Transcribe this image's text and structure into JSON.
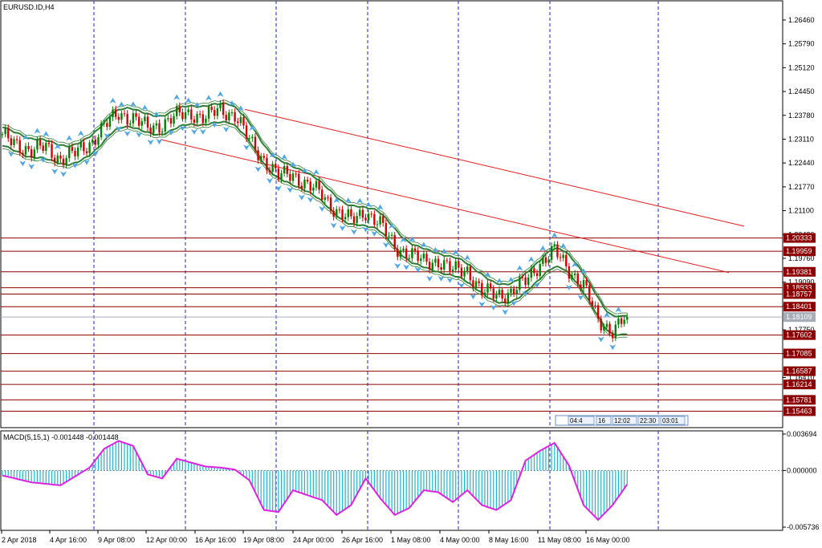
{
  "window": {
    "title": "EURUSD.ID,H4",
    "macd_label": "MACD(5,15,1) -0.001448 -0.001448"
  },
  "colors": {
    "bull_candle": "#008000",
    "bear_candle": "#d00000",
    "band": "#2e7d32",
    "channel": "#e31a1c",
    "level_line": "#8b0000",
    "macd_hist": "#1fb5c7",
    "macd_signal": "#e020e0",
    "grid": "#2020c0",
    "fractal": "#4da6e6",
    "current_price": "#a7adb7"
  },
  "price_axis": {
    "ticks": [
      "1.26460",
      "1.25790",
      "1.25120",
      "1.24450",
      "1.23780",
      "1.23110",
      "1.22440",
      "1.21770",
      "1.21100",
      "1.20430",
      "1.19760",
      "1.19090",
      "1.18420",
      "1.17750",
      "1.17080",
      "1.16410"
    ],
    "range": [
      1.15,
      1.27
    ]
  },
  "price_levels": [
    {
      "label": "1.20333",
      "price": 1.20333,
      "style": "level"
    },
    {
      "label": "1.19959",
      "price": 1.19959,
      "style": "level"
    },
    {
      "label": "1.19381",
      "price": 1.19381,
      "style": "level"
    },
    {
      "label": "1.18933",
      "price": 1.18933,
      "style": "level"
    },
    {
      "label": "1.18757",
      "price": 1.18757,
      "style": "level"
    },
    {
      "label": "1.18401",
      "price": 1.18401,
      "style": "level"
    },
    {
      "label": "1.18109",
      "price": 1.18109,
      "style": "current"
    },
    {
      "label": "1.17602",
      "price": 1.17602,
      "style": "level"
    },
    {
      "label": "1.17085",
      "price": 1.17085,
      "style": "level"
    },
    {
      "label": "1.16587",
      "price": 1.16587,
      "style": "level"
    },
    {
      "label": "1.16214",
      "price": 1.16214,
      "style": "level"
    },
    {
      "label": "1.15781",
      "price": 1.15781,
      "style": "level"
    },
    {
      "label": "1.15463",
      "price": 1.15463,
      "style": "level"
    }
  ],
  "macd_axis": {
    "ticks": [
      "0.003694",
      "0.000000",
      "-0.005736"
    ],
    "range": [
      -0.005736,
      0.003694
    ]
  },
  "time_axis": [
    "2 Apr 2018",
    "4 Apr 16:00",
    "9 Apr 08:00",
    "12 Apr 00:00",
    "16 Apr 16:00",
    "19 Apr 08:00",
    "24 Apr 00:00",
    "26 Apr 16:00",
    "1 May 08:00",
    "4 May 00:00",
    "8 May 16:00",
    "11 May 08:00",
    "16 May 00:00"
  ],
  "time_boxes": [
    "04:4",
    "16",
    "12:02",
    "22:30",
    "03:01"
  ],
  "chart_data": {
    "type": "candlestick",
    "symbol": "EURUSD.ID",
    "timeframe": "H4",
    "close_anchors": [
      [
        0,
        1.2315
      ],
      [
        5,
        1.23
      ],
      [
        10,
        1.2275
      ],
      [
        15,
        1.229
      ],
      [
        20,
        1.2255
      ],
      [
        25,
        1.227
      ],
      [
        30,
        1.23
      ],
      [
        35,
        1.2345
      ],
      [
        40,
        1.2385
      ],
      [
        45,
        1.237
      ],
      [
        50,
        1.234
      ],
      [
        55,
        1.2355
      ],
      [
        60,
        1.2375
      ],
      [
        65,
        1.2385
      ],
      [
        70,
        1.237
      ],
      [
        75,
        1.2395
      ],
      [
        80,
        1.238
      ],
      [
        85,
        1.2305
      ],
      [
        90,
        1.2255
      ],
      [
        95,
        1.2205
      ],
      [
        100,
        1.2215
      ],
      [
        105,
        1.218
      ],
      [
        110,
        1.2155
      ],
      [
        115,
        1.211
      ],
      [
        120,
        1.208
      ],
      [
        125,
        1.211
      ],
      [
        130,
        1.207
      ],
      [
        135,
        1.201
      ],
      [
        140,
        1.199
      ],
      [
        145,
        1.1965
      ],
      [
        150,
        1.197
      ],
      [
        155,
        1.194
      ],
      [
        160,
        1.1945
      ],
      [
        165,
        1.188
      ],
      [
        170,
        1.1875
      ],
      [
        175,
        1.188
      ],
      [
        180,
        1.191
      ],
      [
        185,
        1.1965
      ],
      [
        190,
        1.1995
      ],
      [
        195,
        1.1945
      ],
      [
        200,
        1.19
      ],
      [
        205,
        1.18
      ],
      [
        210,
        1.1775
      ],
      [
        215,
        1.181
      ]
    ],
    "last_close": 1.18109,
    "macd_anchors": [
      [
        0,
        -0.0005
      ],
      [
        10,
        -0.0012
      ],
      [
        20,
        -0.0015
      ],
      [
        30,
        0.0003
      ],
      [
        35,
        0.0022
      ],
      [
        40,
        0.003
      ],
      [
        45,
        0.0025
      ],
      [
        50,
        -0.0004
      ],
      [
        55,
        -0.0008
      ],
      [
        60,
        0.0012
      ],
      [
        65,
        0.0008
      ],
      [
        70,
        0.0004
      ],
      [
        75,
        0.0003
      ],
      [
        80,
        0.0001
      ],
      [
        85,
        -0.001
      ],
      [
        90,
        -0.004
      ],
      [
        95,
        -0.0042
      ],
      [
        100,
        -0.002
      ],
      [
        105,
        -0.0025
      ],
      [
        110,
        -0.003
      ],
      [
        115,
        -0.0045
      ],
      [
        120,
        -0.0035
      ],
      [
        125,
        -0.0008
      ],
      [
        130,
        -0.0028
      ],
      [
        135,
        -0.0045
      ],
      [
        140,
        -0.0038
      ],
      [
        145,
        -0.002
      ],
      [
        150,
        -0.0022
      ],
      [
        155,
        -0.0032
      ],
      [
        160,
        -0.002
      ],
      [
        165,
        -0.0035
      ],
      [
        170,
        -0.004
      ],
      [
        175,
        -0.003
      ],
      [
        180,
        0.001
      ],
      [
        185,
        0.002
      ],
      [
        190,
        0.0028
      ],
      [
        195,
        0.0005
      ],
      [
        200,
        -0.0035
      ],
      [
        205,
        -0.005
      ],
      [
        210,
        -0.0035
      ],
      [
        215,
        -0.0014
      ]
    ]
  }
}
